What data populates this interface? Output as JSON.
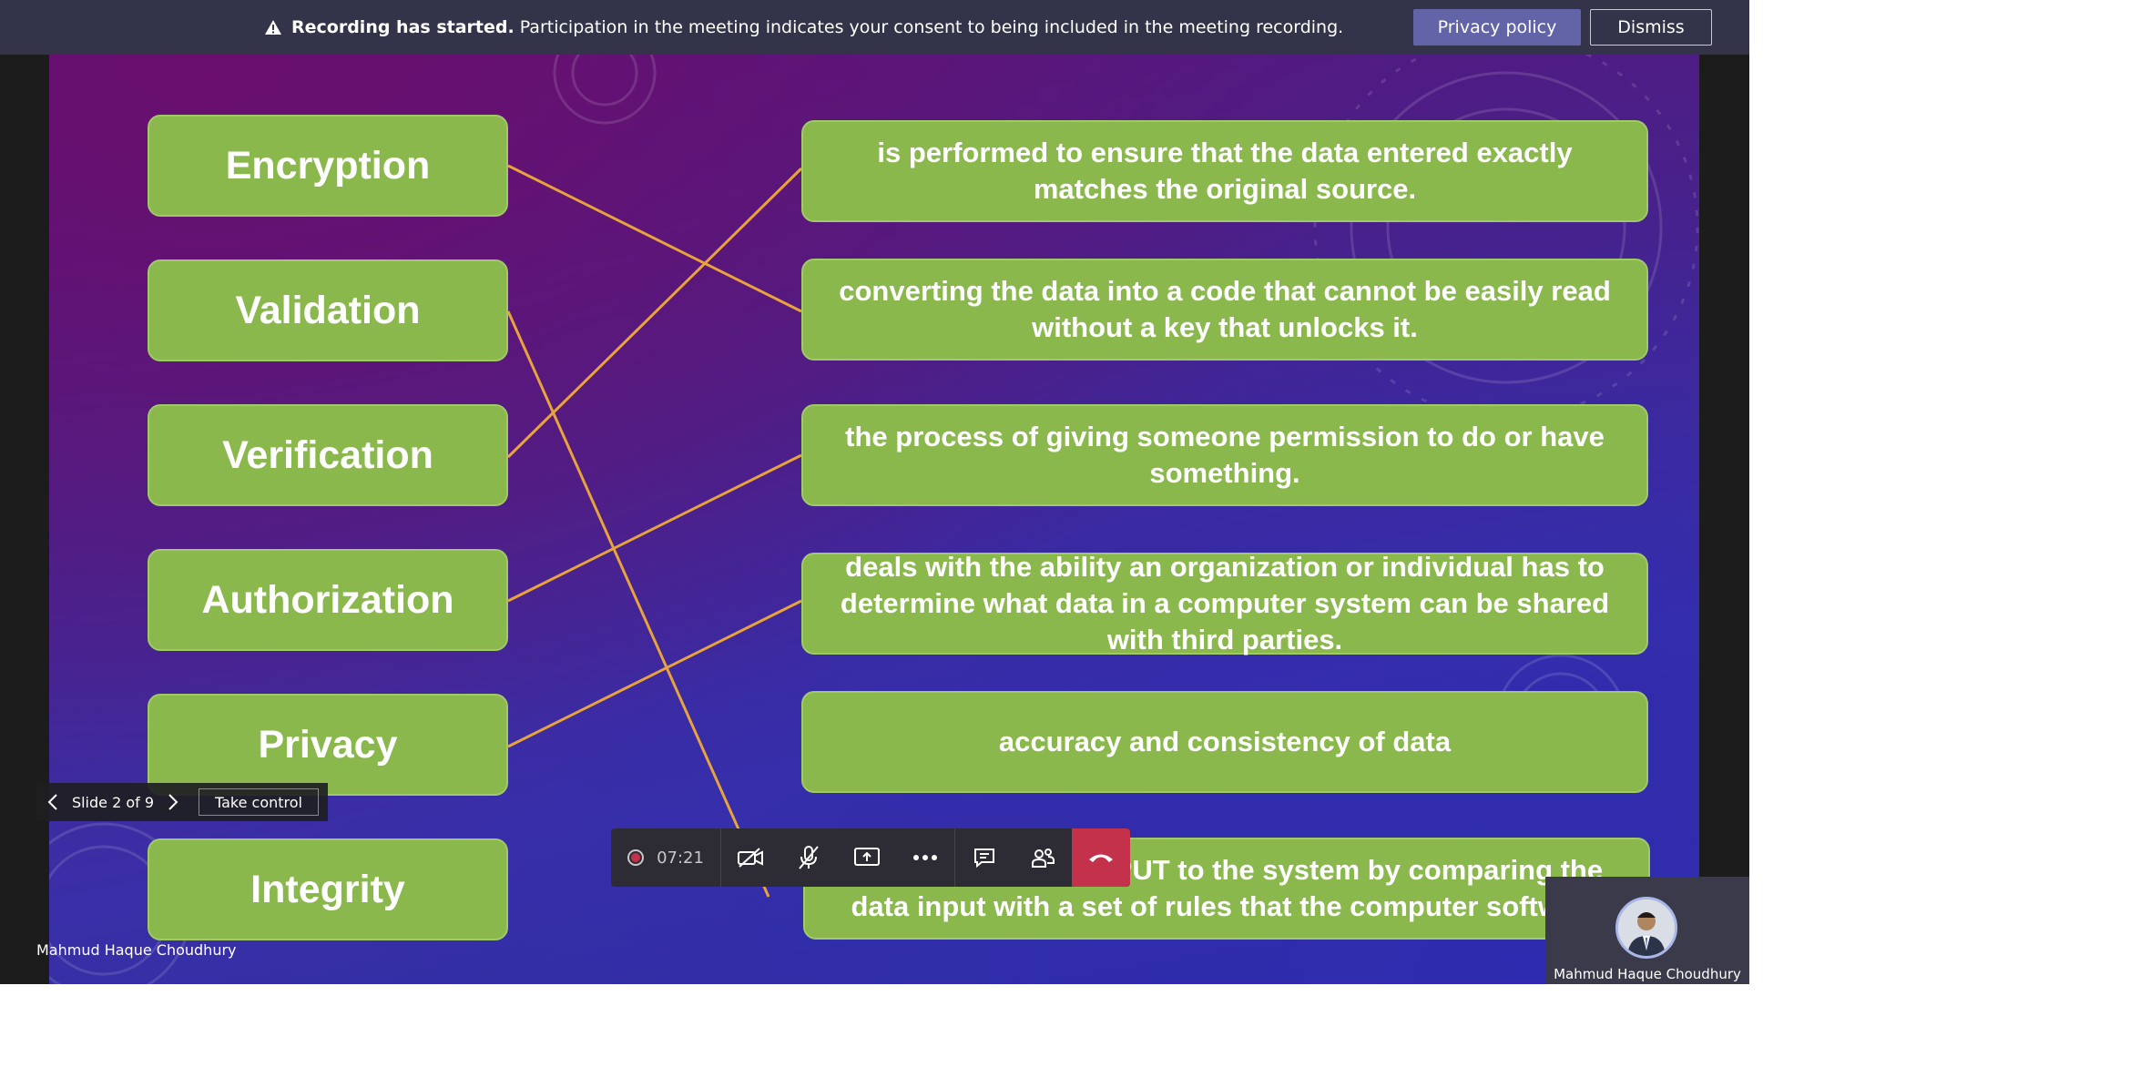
{
  "banner": {
    "title": "Recording has started.",
    "message": "Participation in the meeting indicates your consent to being included in the meeting recording.",
    "privacy_label": "Privacy policy",
    "dismiss_label": "Dismiss"
  },
  "slide": {
    "terms": [
      "Encryption",
      "Validation",
      "Verification",
      "Authorization",
      "Privacy",
      "Integrity"
    ],
    "definitions": [
      "is performed to ensure that the data entered exactly matches the original source.",
      "converting the data into a code that cannot be easily read without a key that unlocks it.",
      "the process of giving someone permission to do or have something.",
      "deals with the ability an organization or individual has to determine what data in a computer system can be shared with third parties.",
      "accuracy and consistency of data",
      "a check on DATA INPUT to the system by comparing the data input with a set of rules that the computer software"
    ],
    "connector_color": "#e8a33a",
    "box_color": "#8ab84d"
  },
  "slide_nav": {
    "counter": "Slide 2 of 9",
    "take_control_label": "Take control"
  },
  "presenter_name": "Mahmud Haque Choudhury",
  "toolbar": {
    "timer": "07:21",
    "icons": [
      "record-icon",
      "camera-off-icon",
      "mic-off-icon",
      "share-screen-icon",
      "more-icon",
      "chat-icon",
      "participants-icon",
      "hang-up-icon"
    ]
  },
  "participant": {
    "name": "Mahmud Haque Choudhury"
  },
  "colors": {
    "banner_bg": "#33344a",
    "accent": "#6264a7",
    "hangup": "#c4314b"
  }
}
